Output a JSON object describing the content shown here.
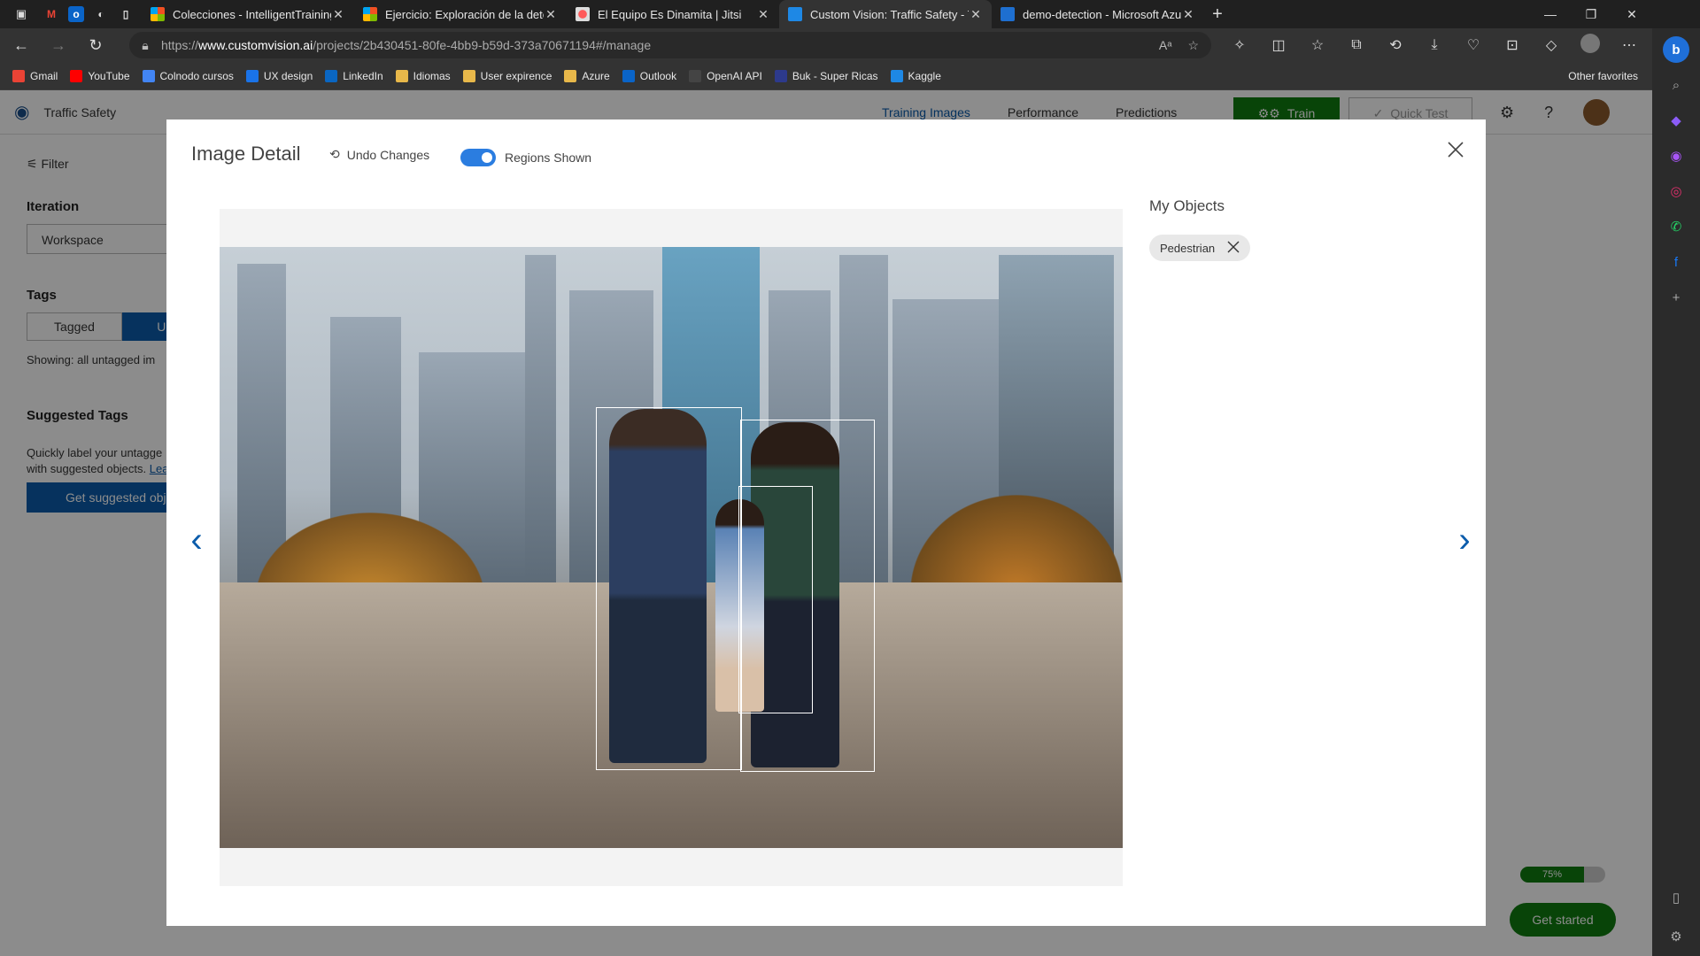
{
  "browser": {
    "tabs": [
      {
        "title": "Colecciones - IntelligentTraining",
        "icon": "microsoft-icon",
        "active": false
      },
      {
        "title": "Ejercicio: Exploración de la detec",
        "icon": "microsoft-icon",
        "active": false
      },
      {
        "title": "El Equipo Es Dinamita | Jitsi",
        "icon": "record-icon",
        "active": false
      },
      {
        "title": "Custom Vision: Traffic Safety - Tr",
        "icon": "customvision-icon",
        "active": true
      },
      {
        "title": "demo-detection - Microsoft Azu",
        "icon": "azure-icon",
        "active": false
      }
    ],
    "url_prefix": "https://",
    "url_host": "www.customvision.ai",
    "url_path": "/projects/2b430451-80fe-4bb9-b59d-373a70671194#/manage",
    "bookmarks": [
      "Gmail",
      "YouTube",
      "Colnodo cursos",
      "UX design",
      "LinkedIn",
      "Idiomas",
      "User expirence",
      "Azure",
      "Outlook",
      "OpenAI API",
      "Buk - Super Ricas",
      "Kaggle"
    ],
    "other_favorites": "Other favorites"
  },
  "app": {
    "project_name": "Traffic Safety",
    "nav": [
      "Training Images",
      "Performance",
      "Predictions"
    ],
    "train_label": "Train",
    "quick_test_label": "Quick Test"
  },
  "sidebar": {
    "filter_label": "Filter",
    "iteration_heading": "Iteration",
    "iteration_value": "Workspace",
    "tags_heading": "Tags",
    "tagged_label": "Tagged",
    "untagged_label": "Unta",
    "showing_text": "Showing: all untagged im",
    "suggested_heading": "Suggested Tags",
    "suggested_text_1": "Quickly label your untagge",
    "suggested_text_2": "with suggested objects.",
    "suggested_link": "Lea",
    "get_suggested_label": "Get suggested obje"
  },
  "onboarding": {
    "progress_text": "75%",
    "progress_value": 0.75,
    "get_started_label": "Get started"
  },
  "modal": {
    "title": "Image Detail",
    "undo_label": "Undo Changes",
    "regions_label": "Regions Shown",
    "regions_shown": true,
    "objects_heading": "My Objects",
    "tags": [
      "Pedestrian"
    ]
  },
  "colors": {
    "accent": "#0b5cab",
    "train_green": "#107c10",
    "toggle_blue": "#2b7de0"
  }
}
